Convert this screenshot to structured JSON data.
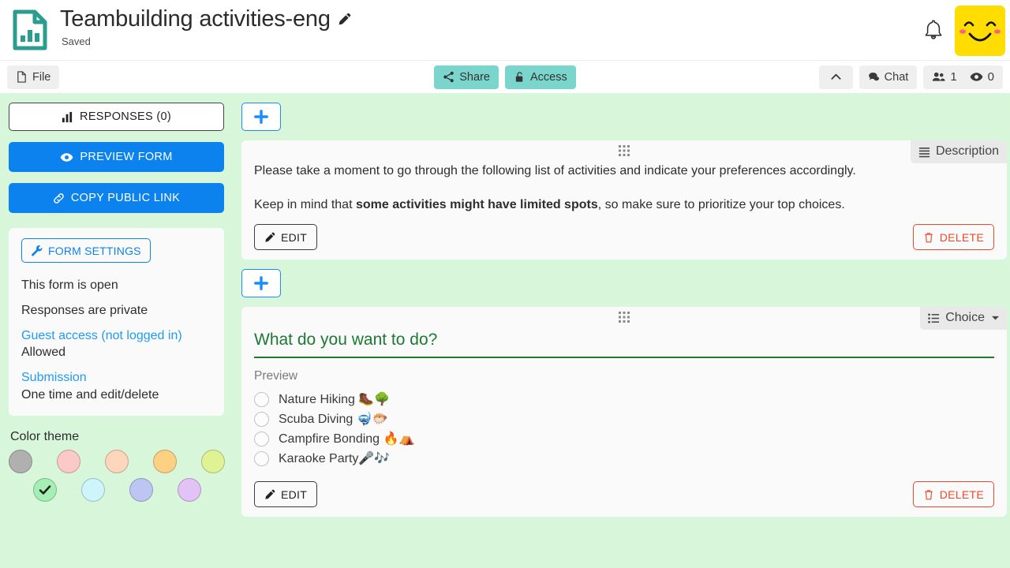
{
  "header": {
    "logo_icon": "file-chart-icon",
    "title": "Teambuilding activities-eng",
    "edit_title_icon": "pencil-icon",
    "status": "Saved",
    "bell_icon": "bell-icon",
    "avatar_icon": "smiley-avatar",
    "accent_teal": "#7ad6cd",
    "logo_color": "#2a9d8f",
    "avatar_color": "#ffdd00"
  },
  "toolbar": {
    "file_label": "File",
    "file_icon": "file-icon",
    "share_label": "Share",
    "share_icon": "share-icon",
    "access_label": "Access",
    "access_icon": "lock-open-icon",
    "collapse_icon": "chevron-up-icon",
    "chat_label": "Chat",
    "chat_icon": "chat-bubble-icon",
    "users_icon": "users-icon",
    "users_count": "1",
    "views_icon": "eye-icon",
    "views_count": "0"
  },
  "sidebar": {
    "responses_label": "RESPONSES (0)",
    "responses_icon": "bar-chart-icon",
    "preview_label": "PREVIEW FORM",
    "preview_icon": "eye-icon",
    "copy_link_label": "COPY PUBLIC LINK",
    "copy_link_icon": "link-icon",
    "settings_button_label": "FORM SETTINGS",
    "settings_icon": "wrench-icon",
    "settings_lines": [
      {
        "type": "text",
        "text": "This form is open"
      },
      {
        "type": "text",
        "text": "Responses are private"
      },
      {
        "type": "link",
        "text": "Guest access (not logged in)"
      },
      {
        "type": "sub",
        "text": "Allowed"
      },
      {
        "type": "link",
        "text": "Submission"
      },
      {
        "type": "sub",
        "text": "One time and edit/delete"
      }
    ],
    "theme_title": "Color theme",
    "theme_check_icon": "check-icon",
    "theme_row1": [
      "#b0b0b0",
      "#fcc9c9",
      "#fdd6bb",
      "#fcd183",
      "#dff394"
    ],
    "theme_row2": [
      "#a5eeb4",
      "#cdf5fb",
      "#bdc5f2",
      "#e2c2f7"
    ],
    "theme_selected_index": 0
  },
  "content": {
    "add_button_icon": "plus-icon",
    "drag_handle_icon": "drag-grid-icon",
    "cards": [
      {
        "badge_label": "Description",
        "badge_icon": "list-lines-icon",
        "has_caret": false,
        "paragraphs": [
          {
            "parts": [
              {
                "text": "Please take a moment to go through the following list of activities and indicate your preferences accordingly.",
                "bold": false
              }
            ]
          },
          {
            "parts": [
              {
                "text": "Keep in mind that ",
                "bold": false
              },
              {
                "text": "some activities might have limited spots",
                "bold": true
              },
              {
                "text": ", so make sure to prioritize your top choices.",
                "bold": false
              }
            ]
          }
        ],
        "edit_label": "EDIT",
        "edit_icon": "pencil-icon",
        "delete_label": "DELETE",
        "delete_icon": "trash-icon"
      },
      {
        "badge_label": "Choice",
        "badge_icon": "list-bullets-icon",
        "has_caret": true,
        "question": "What do you want to do?",
        "preview_label": "Preview",
        "options": [
          "Nature Hiking 🥾🌳",
          "Scuba Diving 🤿🐡",
          "Campfire Bonding 🔥⛺",
          "Karaoke Party🎤🎶"
        ],
        "edit_label": "EDIT",
        "edit_icon": "pencil-icon",
        "delete_label": "DELETE",
        "delete_icon": "trash-icon"
      }
    ]
  }
}
